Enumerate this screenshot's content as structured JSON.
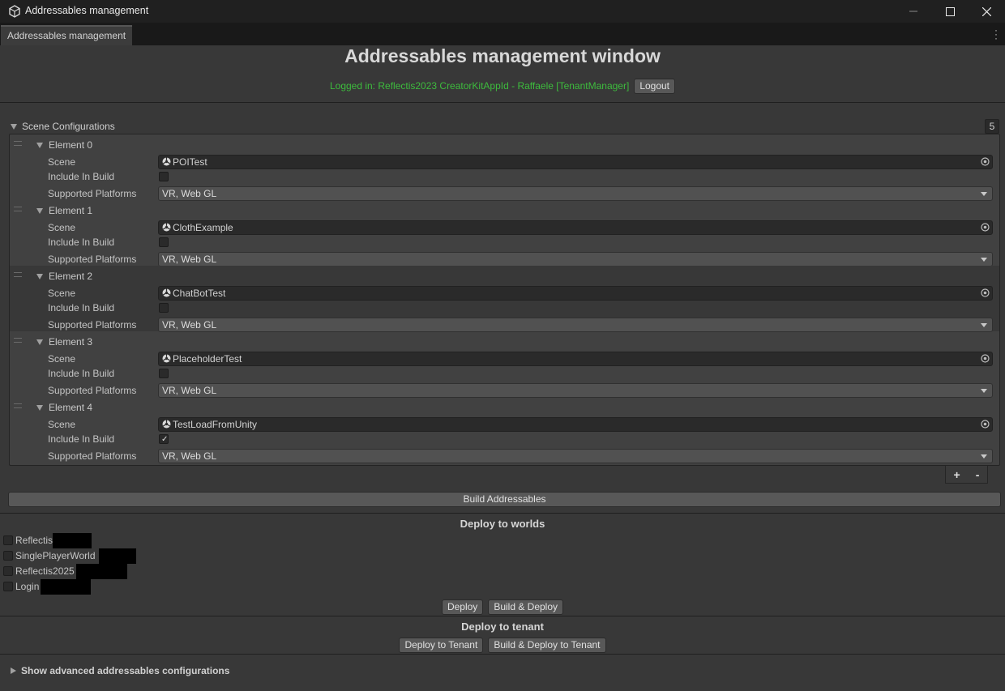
{
  "window": {
    "title": "Addressables management",
    "tab_label": "Addressables management"
  },
  "header": {
    "title": "Addressables management window",
    "login_text": "Logged in: Reflectis2023 CreatorKitAppId - Raffaele [TenantManager]",
    "logout_label": "Logout"
  },
  "scene_configurations": {
    "label": "Scene Configurations",
    "count": "5",
    "field_labels": {
      "scene": "Scene",
      "include": "Include In Build",
      "platforms": "Supported Platforms"
    },
    "elements": [
      {
        "title": "Element 0",
        "scene": "POITest",
        "include_in_build": false,
        "platforms": "VR, Web GL"
      },
      {
        "title": "Element 1",
        "scene": "ClothExample",
        "include_in_build": false,
        "platforms": "VR, Web GL"
      },
      {
        "title": "Element 2",
        "scene": "ChatBotTest",
        "include_in_build": false,
        "platforms": "VR, Web GL"
      },
      {
        "title": "Element 3",
        "scene": "PlaceholderTest",
        "include_in_build": false,
        "platforms": "VR, Web GL"
      },
      {
        "title": "Element 4",
        "scene": "TestLoadFromUnity",
        "include_in_build": true,
        "platforms": "VR, Web GL"
      }
    ],
    "add_label": "+",
    "remove_label": "-"
  },
  "build_addressables_label": "Build Addressables",
  "deploy_worlds": {
    "title": "Deploy to worlds",
    "worlds": [
      {
        "name": "Reflectis",
        "checked": false
      },
      {
        "name": "SinglePlayerWorld",
        "checked": false
      },
      {
        "name": "Reflectis2025",
        "checked": false
      },
      {
        "name": "Login",
        "checked": false
      }
    ],
    "deploy_label": "Deploy",
    "build_deploy_label": "Build & Deploy"
  },
  "deploy_tenant": {
    "title": "Deploy to tenant",
    "deploy_label": "Deploy to Tenant",
    "build_deploy_label": "Build & Deploy to Tenant"
  },
  "advanced_label": "Show advanced addressables configurations",
  "colors": {
    "background": "#383838",
    "login_green": "#3dbb3d",
    "titlebar": "#202020"
  }
}
